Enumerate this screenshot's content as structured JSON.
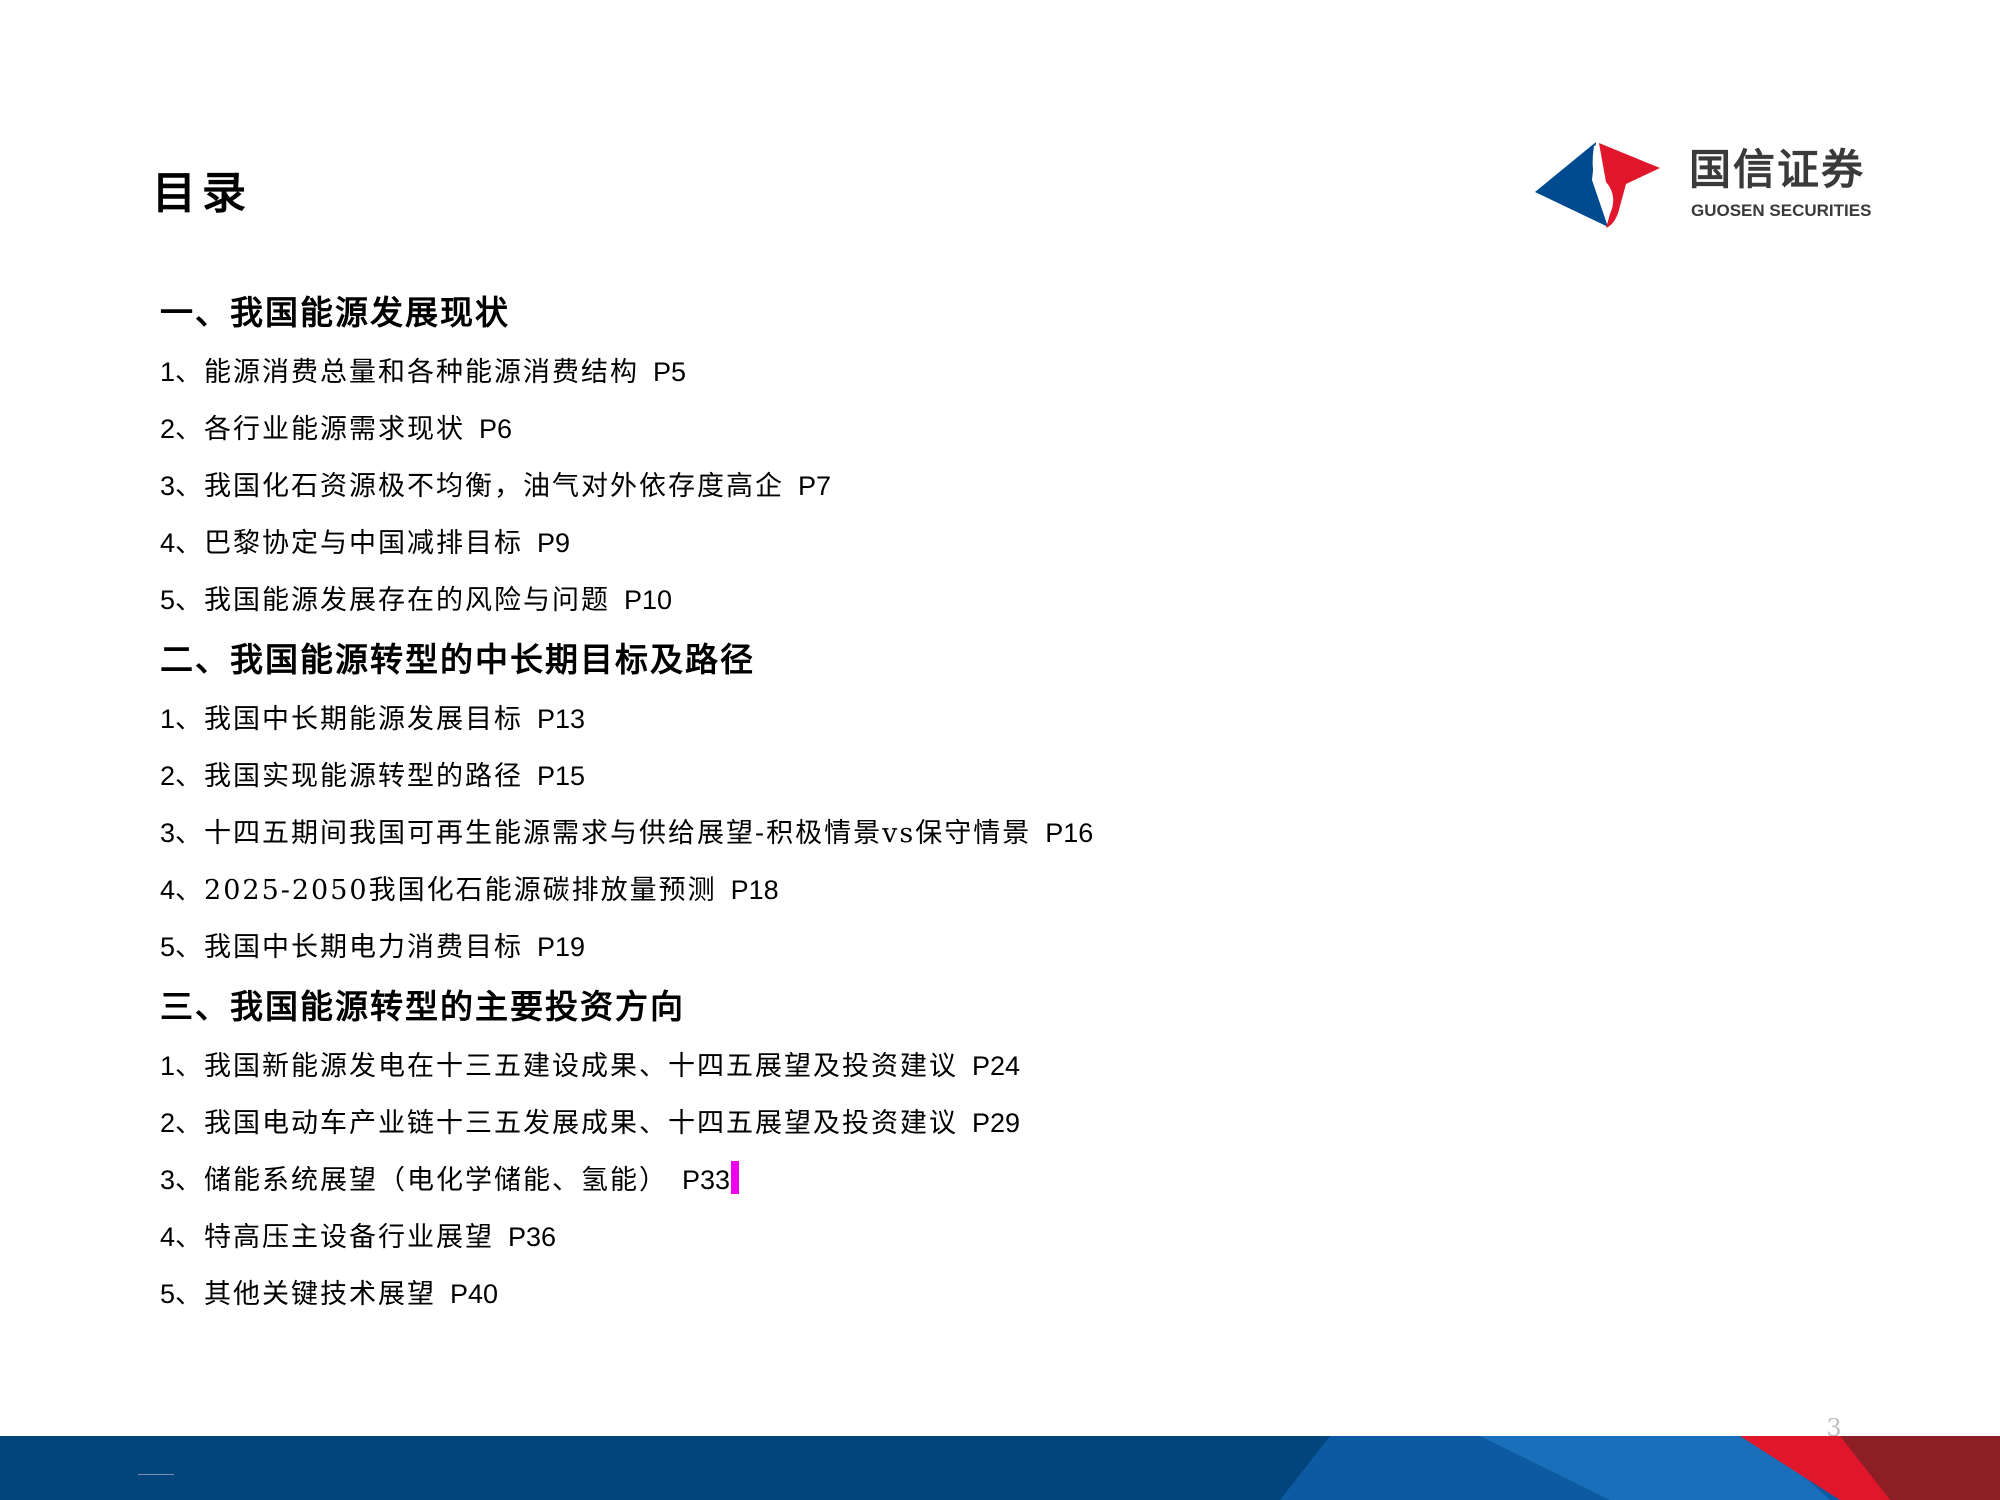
{
  "page": {
    "title": "目录",
    "page_number": "3"
  },
  "logo": {
    "name_cn": "国信证券",
    "name_en": "GUOSEN SECURITIES",
    "colors": {
      "blue": "#004a8f",
      "red": "#e0162b",
      "text": "#3a3a3a"
    }
  },
  "toc": [
    {
      "heading": "一、我国能源发展现状",
      "items": [
        {
          "num": "1",
          "text": "、能源消费总量和各种能源消费结构",
          "page": "P5"
        },
        {
          "num": "2",
          "text": "、各行业能源需求现状",
          "page": "P6"
        },
        {
          "num": "3",
          "text": "、我国化石资源极不均衡，油气对外依存度高企",
          "page": "P7"
        },
        {
          "num": "4",
          "text": "、巴黎协定与中国减排目标",
          "page": "P9"
        },
        {
          "num": "5",
          "text": "、我国能源发展存在的风险与问题",
          "page": "P10"
        }
      ]
    },
    {
      "heading": "二、我国能源转型的中长期目标及路径",
      "items": [
        {
          "num": "1",
          "text": "、我国中长期能源发展目标",
          "page": "P13"
        },
        {
          "num": "2",
          "text": "、我国实现能源转型的路径",
          "page": "P15"
        },
        {
          "num": "3",
          "text": "、十四五期间我国可再生能源需求与供给展望-积极情景vs保守情景",
          "page": "P16"
        },
        {
          "num": "4",
          "text": "、2025-2050我国化石能源碳排放量预测",
          "page": "P18"
        },
        {
          "num": "5",
          "text": "、我国中长期电力消费目标",
          "page": "P19"
        }
      ]
    },
    {
      "heading": "三、我国能源转型的主要投资方向",
      "items": [
        {
          "num": "1",
          "text": "、我国新能源发电在十三五建设成果、十四五展望及投资建议",
          "page": "P24"
        },
        {
          "num": "2",
          "text": "、我国电动车产业链十三五发展成果、十四五展望及投资建议",
          "page": "P29"
        },
        {
          "num": "3",
          "text": "、储能系统展望（电化学储能、氢能）",
          "page": "P33",
          "highlight": "#ee00ee"
        },
        {
          "num": "4",
          "text": "、特高压主设备行业展望",
          "page": "P36"
        },
        {
          "num": "5",
          "text": "、其他关键技术展望",
          "page": "P40"
        }
      ]
    }
  ],
  "footer": {
    "colors": {
      "dark_blue": "#02457d",
      "mid_blue": "#0d5aa3",
      "light_blue": "#1a6fbb",
      "red": "#e0162b",
      "dark_red": "#8e1e26"
    }
  }
}
